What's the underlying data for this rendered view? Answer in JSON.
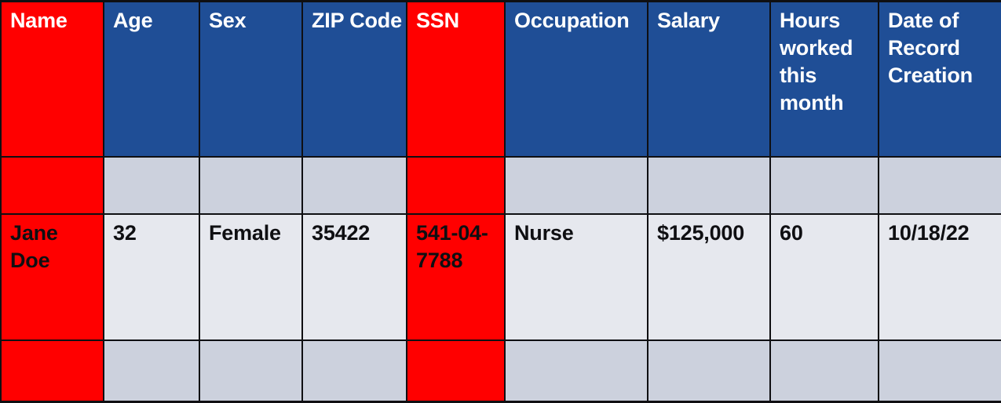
{
  "table": {
    "columns": [
      {
        "key": "name",
        "label": "Name",
        "highlight": "sensitive"
      },
      {
        "key": "age",
        "label": "Age",
        "highlight": "normal"
      },
      {
        "key": "sex",
        "label": "Sex",
        "highlight": "normal"
      },
      {
        "key": "zip",
        "label": "ZIP Code",
        "highlight": "normal"
      },
      {
        "key": "ssn",
        "label": "SSN",
        "highlight": "sensitive"
      },
      {
        "key": "occupation",
        "label": "Occupation",
        "highlight": "normal"
      },
      {
        "key": "salary",
        "label": "Salary",
        "highlight": "normal"
      },
      {
        "key": "hours",
        "label": "Hours worked this month",
        "highlight": "normal"
      },
      {
        "key": "created",
        "label": "Date of Record Creation",
        "highlight": "normal"
      }
    ],
    "rows": [
      {
        "type": "empty",
        "cells": [
          "",
          "",
          "",
          "",
          "",
          "",
          "",
          "",
          ""
        ]
      },
      {
        "type": "data",
        "cells": [
          "Jane Doe",
          "32",
          "Female",
          "35422",
          "541-04-7788",
          "Nurse",
          "$125,000",
          "60",
          "10/18/22"
        ]
      },
      {
        "type": "empty",
        "cells": [
          "",
          "",
          "",
          "",
          "",
          "",
          "",
          "",
          ""
        ]
      }
    ]
  },
  "colors": {
    "header_blue": "#1f4e96",
    "highlight_red": "#ff0000",
    "row_light": "#e6e8ee",
    "row_dark": "#ccd1dd",
    "border": "#0f0f12",
    "header_text": "#ffffff",
    "body_text": "#0f0f12"
  }
}
